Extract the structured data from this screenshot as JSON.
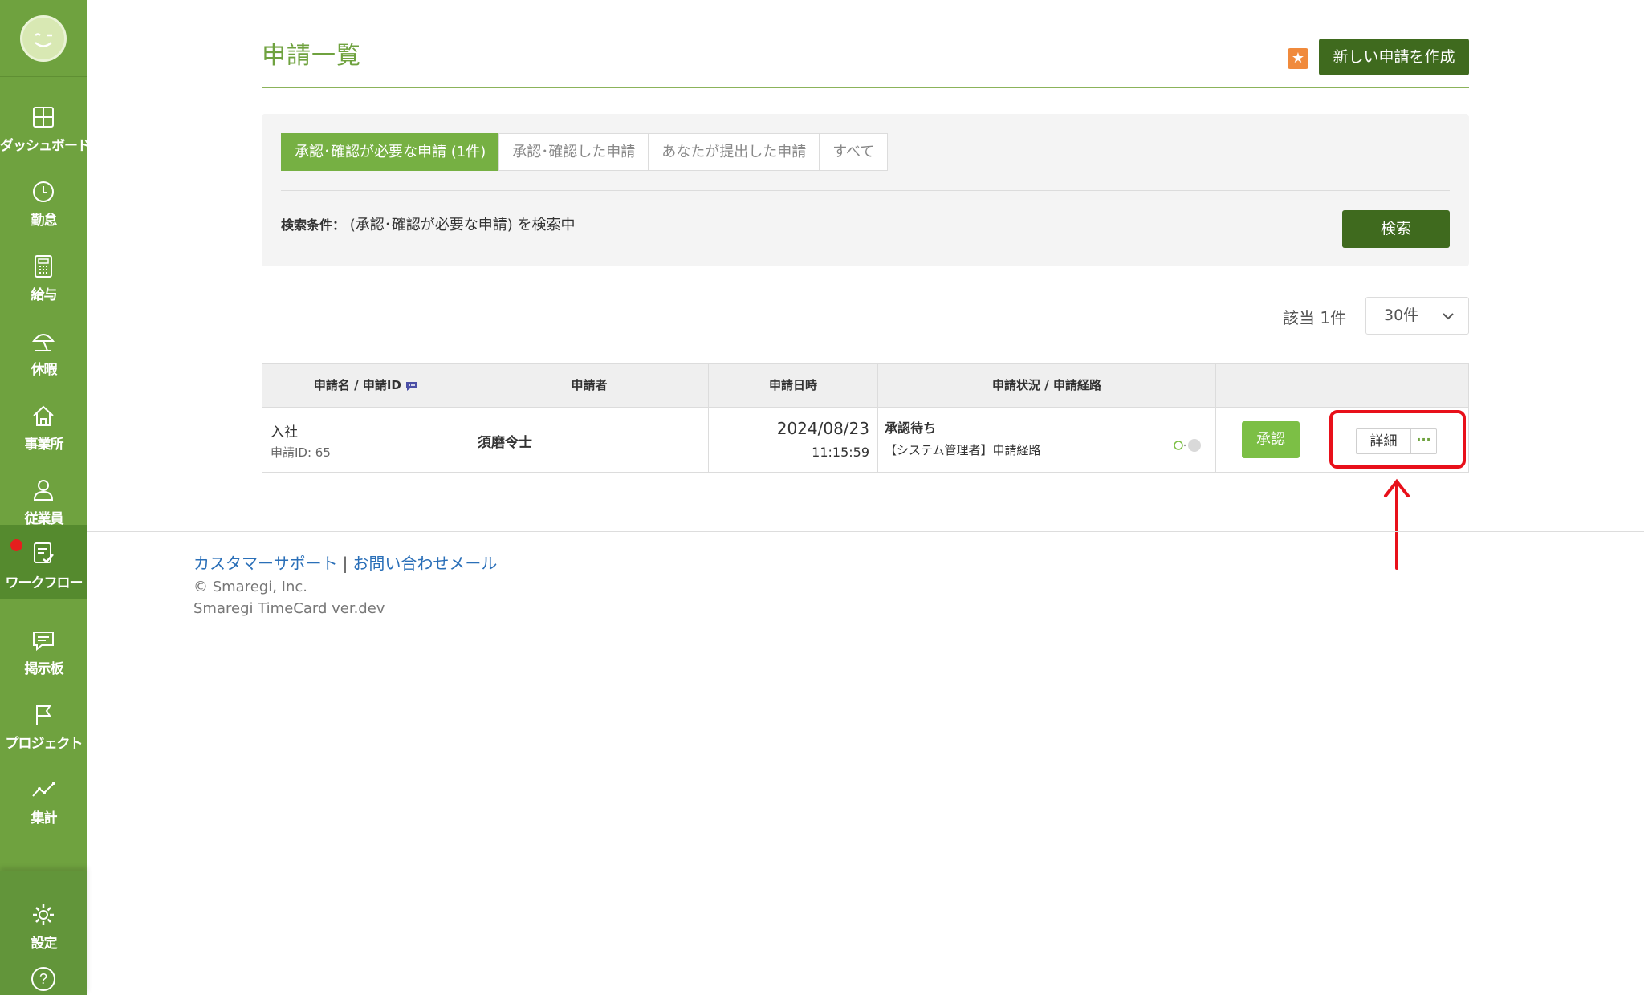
{
  "sidebar": {
    "items": [
      {
        "label": "ダッシュボード",
        "icon": "dashboard-icon"
      },
      {
        "label": "勤怠",
        "icon": "clock-icon"
      },
      {
        "label": "給与",
        "icon": "calculator-icon"
      },
      {
        "label": "休暇",
        "icon": "beach-umbrella-icon"
      },
      {
        "label": "事業所",
        "icon": "home-icon"
      },
      {
        "label": "従業員",
        "icon": "person-icon"
      },
      {
        "label": "ワークフロー",
        "icon": "workflow-icon"
      },
      {
        "label": "掲示板",
        "icon": "chat-icon"
      },
      {
        "label": "プロジェクト",
        "icon": "flag-icon"
      },
      {
        "label": "集計",
        "icon": "line-chart-icon"
      }
    ],
    "settings_label": "設定",
    "help_label": "?"
  },
  "header": {
    "title": "申請一覧",
    "star": "★",
    "create_button": "新しい申請を作成"
  },
  "filter": {
    "tabs": [
      "承認･確認が必要な申請 (1件)",
      "承認･確認した申請",
      "あなたが提出した申請",
      "すべて"
    ],
    "condition_label": "検索条件：",
    "condition_value": "(承認･確認が必要な申請) を検索中",
    "search_button": "検索"
  },
  "results": {
    "count_text": "該当 1件",
    "per_page": "30件"
  },
  "table": {
    "headers": [
      "申請名 / 申請ID",
      "申請者",
      "申請日時",
      "申請状況 / 申請経路"
    ],
    "row": {
      "name": "入社",
      "id": "申請ID: 65",
      "applicant": "須磨令士",
      "date": "2024/08/23",
      "time": "11:15:59",
      "status": "承認待ち",
      "route": "【システム管理者】申請経路",
      "approve_button": "承認",
      "detail_button": "詳細",
      "more_button": "···"
    }
  },
  "footer": {
    "support_link": "カスタマーサポート",
    "separator": "|",
    "contact_link": "お問い合わせメール",
    "copyright": "© Smaregi, Inc.",
    "version": "Smaregi TimeCard ver.dev"
  },
  "colors": {
    "sidebar": "#6fa23f",
    "primary_dark": "#3f6a1e",
    "accent": "#76b043",
    "highlight": "#e8101a"
  }
}
